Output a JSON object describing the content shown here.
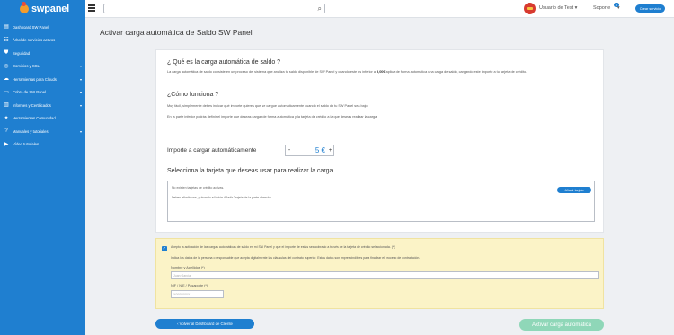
{
  "brand": {
    "logo_text": "swpanel"
  },
  "sidebar": {
    "items": [
      {
        "label": "Dashboard SW Panel",
        "icon": "dashboard-icon",
        "chevron": false
      },
      {
        "label": "Árbol de servicios activos",
        "icon": "tree-icon",
        "chevron": false
      },
      {
        "label": "Seguridad",
        "icon": "shield-icon",
        "chevron": false
      },
      {
        "label": "Dominios y SSL",
        "icon": "globe-icon",
        "chevron": true
      },
      {
        "label": "Herramientas para Clouds",
        "icon": "cloud-icon",
        "chevron": true
      },
      {
        "label": "Cobra de SW Panel",
        "icon": "money-icon",
        "chevron": true
      },
      {
        "label": "Informes y Certificados",
        "icon": "chart-icon",
        "chevron": true
      },
      {
        "label": "Herramientas Comunidad",
        "icon": "tools-icon",
        "chevron": false
      },
      {
        "label": "Manuales y tutoriales",
        "icon": "help-icon",
        "chevron": true
      },
      {
        "label": "Vídeo tutoriales",
        "icon": "video-icon",
        "chevron": false
      }
    ]
  },
  "topbar": {
    "search_placeholder": "",
    "user_name": "Usuario de Test",
    "soporte_label": "Soporte",
    "soporte_badge": "0",
    "crear_label": "Crear servicio"
  },
  "main": {
    "page_title": "Activar carga automática de Saldo SW Panel",
    "q1_heading": "¿ Qué es la carga automática de saldo ?",
    "q1_text_1": "La carga automática de saldo consiste en un proceso del sistema que analiza tu saldo disponible de SW Panel y cuando este es inferior a ",
    "q1_text_bold": "5,00€",
    "q1_text_2": " aplica de forma automática una carga de saldo, cargando este importe a tu tarjeta de crédito.",
    "q2_heading": "¿Cómo funciona ?",
    "q2_text_1": "Muy fácil, simplemente debes indicar qué importe quieres que se cargue automáticamente cuando el saldo de tu SW Panel sea bajo.",
    "q2_text_2": "En la parte inferior podrás definir el importe que deseas cargar de forma automática y la tarjeta de crédito a la que deseas realizar la carga.",
    "importe_label": "Importe a cargar automáticamente",
    "importe_minus": "-",
    "importe_value": "5 €",
    "importe_plus": "+",
    "tarjeta_heading": "Selecciona la tarjeta que deseas usar para realizar la carga",
    "no_cards_text": "No existen tarjetas de crédito activas.",
    "add_card_hint": "Debes añadir una, pulsando el botón Añadir Tarjeta de la parte derecha.",
    "add_card_button": "Añadir tarjeta"
  },
  "terms": {
    "checked": true,
    "accept_text": "Acepto la activación de las cargas automáticas de saldo en mi SW Panel y que el importe de estas sea cobrado a través de la tarjeta de crédito seleccionada. (*)",
    "legal_text": "Indica los datos de la persona o responsable que acepta digitalmente las cláusulas del contrato superior. Estos datos son imprescindibles para finalizar el proceso de contratación.",
    "name_label": "Nombre y Apellidos (*)",
    "name_placeholder": "Juan García",
    "nif_label": "NIF / NIE / Pasaporte (*)",
    "nif_placeholder": "X0000000X"
  },
  "actions": {
    "back_label": "‹ Volver al Dashboard de Cliente",
    "activate_label": "Activar carga automática"
  },
  "colors": {
    "primary": "#1f7fd0",
    "activate_disabled": "#8fd7b8",
    "terms_bg": "#fbf3c7"
  }
}
